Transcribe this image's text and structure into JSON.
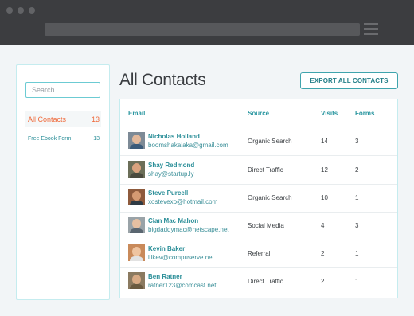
{
  "sidebar": {
    "search_placeholder": "Search",
    "items": [
      {
        "label": "All Contacts",
        "count": "13"
      },
      {
        "label": "Free Ebook Form",
        "count": "13"
      }
    ]
  },
  "main": {
    "title": "All Contacts",
    "export_label": "EXPORT ALL CONTACTS"
  },
  "table": {
    "columns": [
      "Email",
      "Source",
      "Visits",
      "Forms"
    ],
    "rows": [
      {
        "name": "Nicholas Holland",
        "email": "boomshakalaka@gmail.com",
        "source": "Organic Search",
        "visits": "14",
        "forms": "3"
      },
      {
        "name": "Shay Redmond",
        "email": "shay@startup.ly",
        "source": "Direct Traffic",
        "visits": "12",
        "forms": "2"
      },
      {
        "name": "Steve Purcell",
        "email": "xostevexo@hotmail.com",
        "source": "Organic Search",
        "visits": "10",
        "forms": "1"
      },
      {
        "name": "Cian Mac Mahon",
        "email": "bigdaddymac@netscape.net",
        "source": "Social Media",
        "visits": "4",
        "forms": "3"
      },
      {
        "name": "Kevin Baker",
        "email": "lilkev@compuserve.net",
        "source": "Referral",
        "visits": "2",
        "forms": "1"
      },
      {
        "name": "Ben Ratner",
        "email": "ratner123@comcast.net",
        "source": "Direct Traffic",
        "visits": "2",
        "forms": "1"
      }
    ]
  },
  "colors": {
    "accent": "#2a96a0",
    "active": "#ef6a3b",
    "chrome": "#3c3d40"
  }
}
